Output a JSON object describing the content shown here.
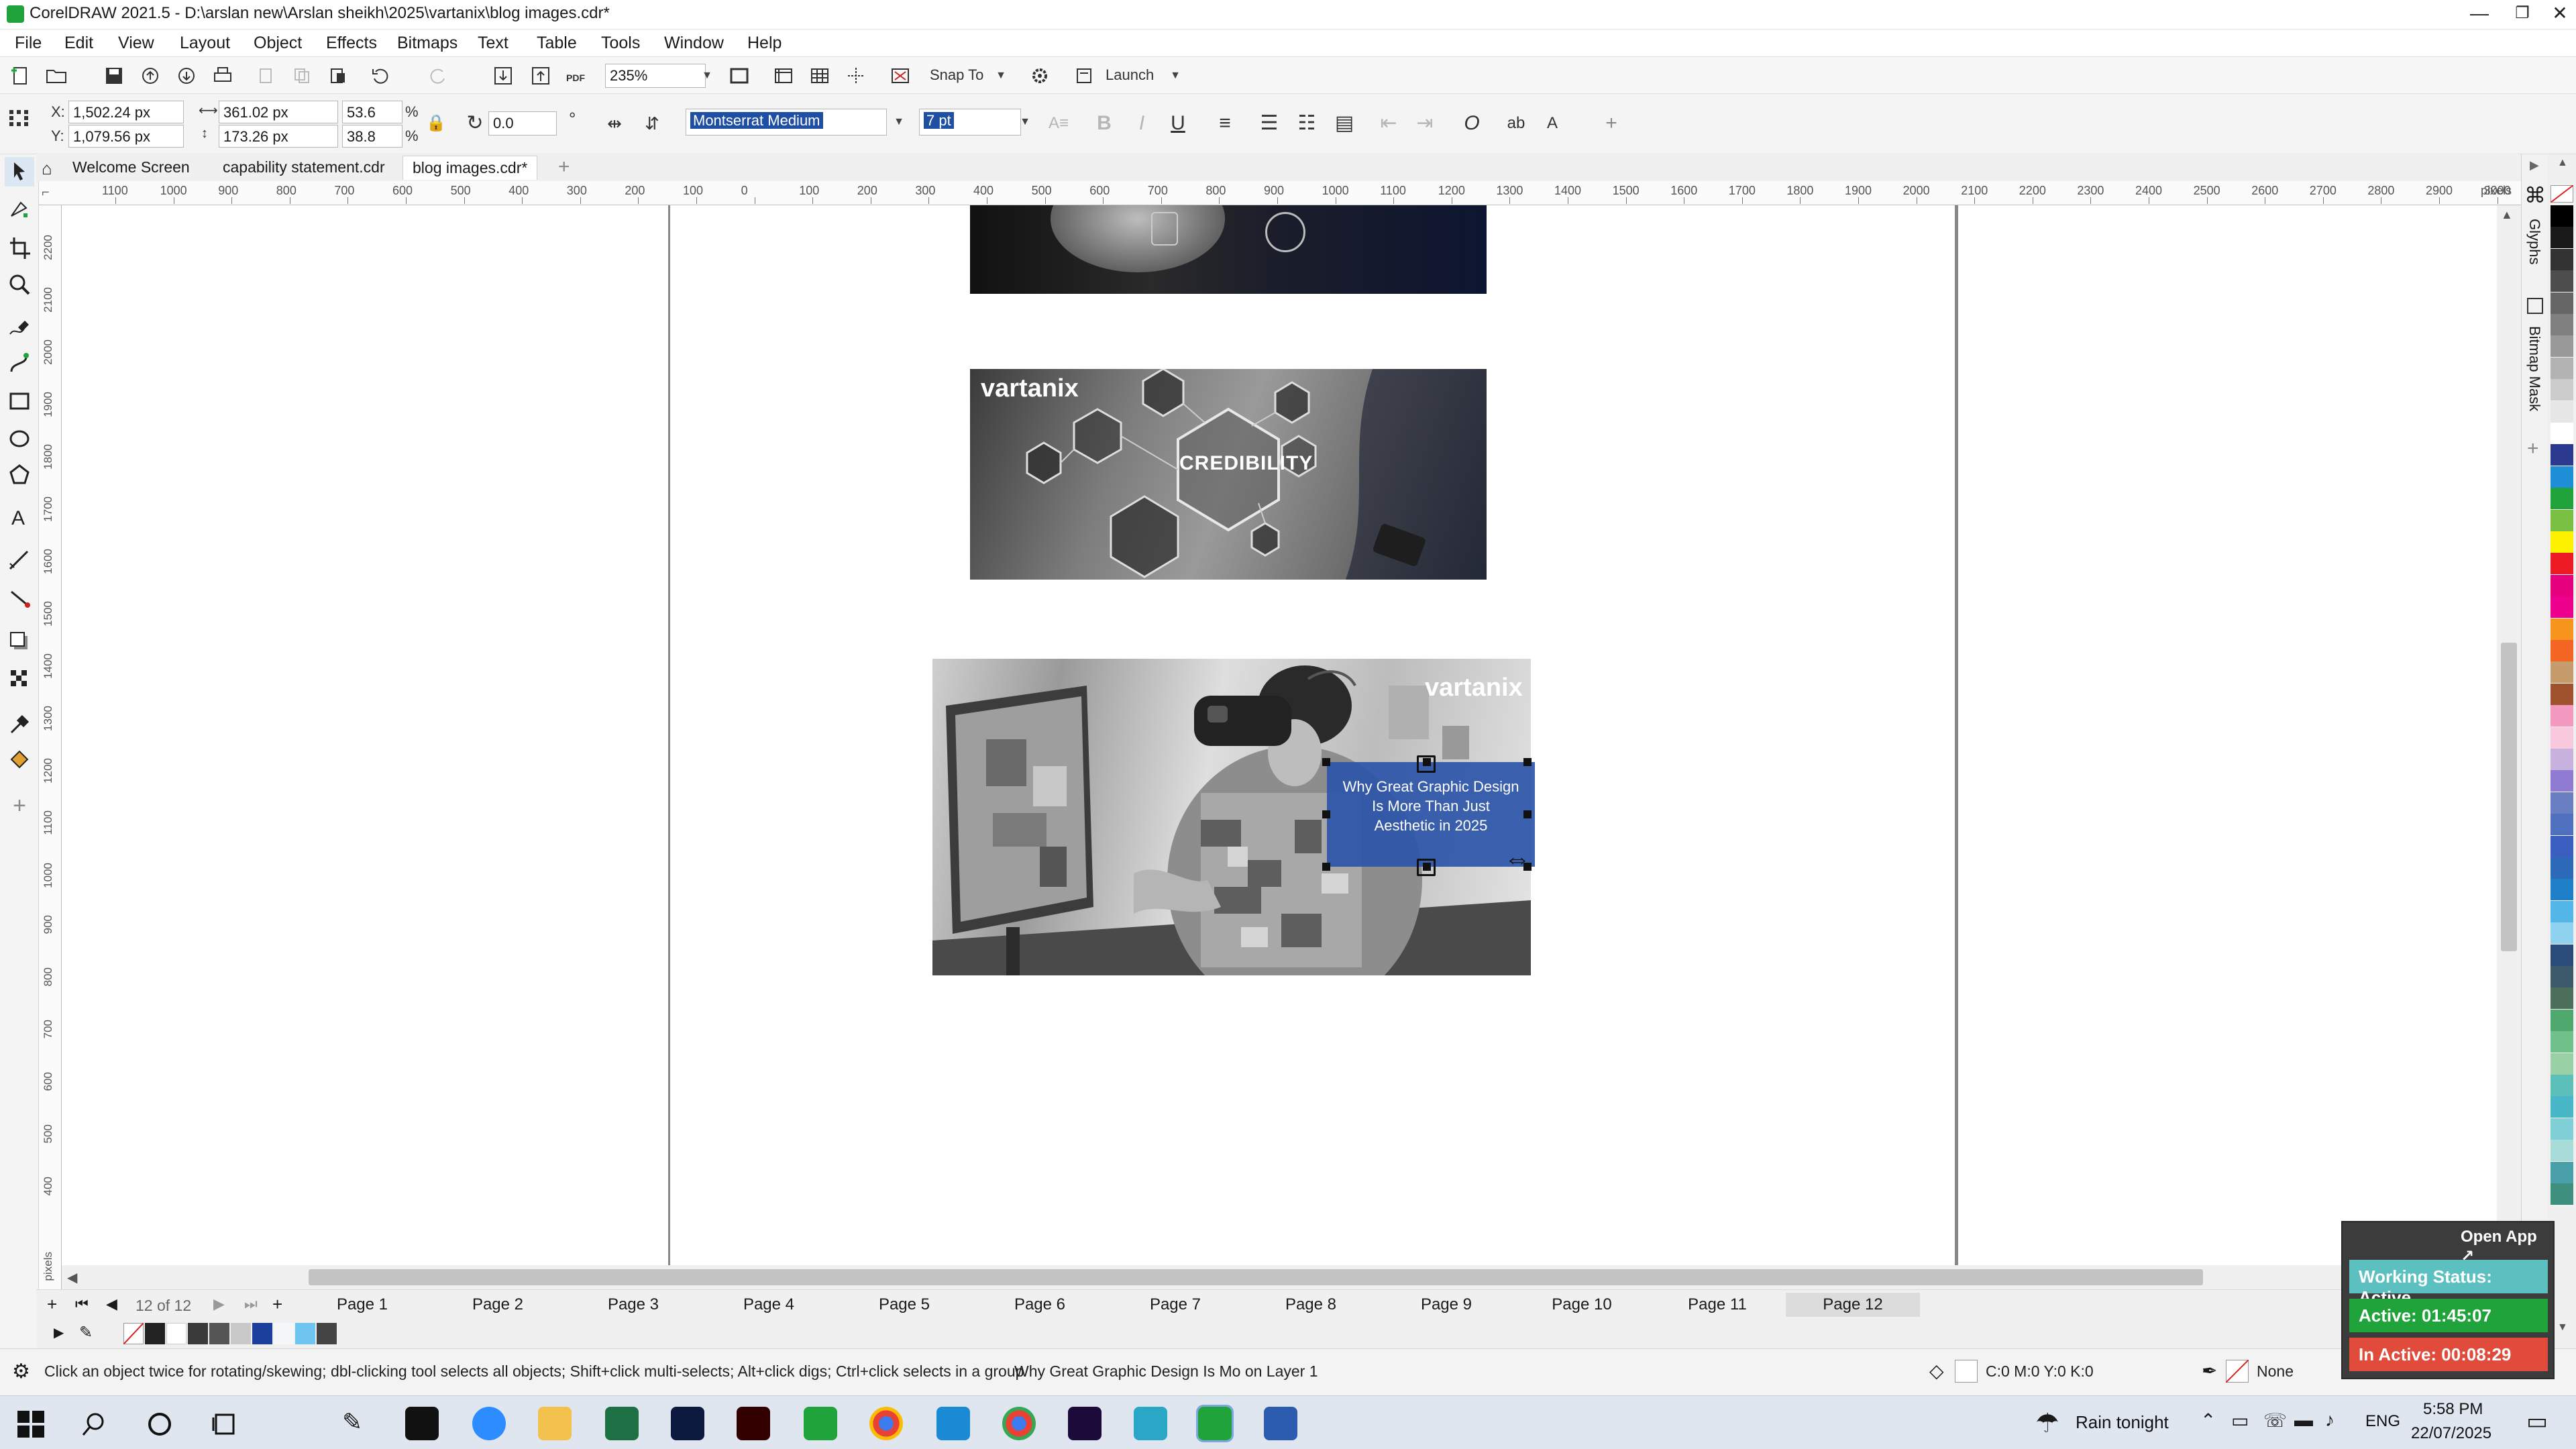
{
  "window": {
    "title": "CorelDRAW 2021.5 - D:\\arslan new\\Arslan sheikh\\2025\\vartanix\\blog images.cdr*",
    "minimize": "—",
    "restore": "❐",
    "close": "✕"
  },
  "menu": [
    "File",
    "Edit",
    "View",
    "Layout",
    "Object",
    "Effects",
    "Bitmaps",
    "Text",
    "Table",
    "Tools",
    "Window",
    "Help"
  ],
  "standard_toolbar": {
    "zoom_value": "235%",
    "snap_label": "Snap To",
    "launch_label": "Launch"
  },
  "property_bar": {
    "x_label": "X:",
    "x_value": "1,502.24 px",
    "y_label": "Y:",
    "y_value": "1,079.56 px",
    "width_value": "361.02 px",
    "height_value": "173.26 px",
    "scale_w": "53.6",
    "scale_h": "38.8",
    "percent": "%",
    "rotation_value": "0.0",
    "degree": "°",
    "font_name": "Montserrat Medium",
    "font_size": "7 pt"
  },
  "doc_tabs": [
    {
      "label": "Welcome Screen",
      "active": false
    },
    {
      "label": "capability statement.cdr",
      "active": false
    },
    {
      "label": "blog images.cdr*",
      "active": true
    }
  ],
  "ruler": {
    "h_labels": [
      "1100",
      "1000",
      "900",
      "800",
      "700",
      "600",
      "500",
      "400",
      "300",
      "200",
      "100",
      "0",
      "100",
      "200",
      "300",
      "400",
      "500",
      "600",
      "700",
      "800",
      "900",
      "1000",
      "1100",
      "1200",
      "1300",
      "1400",
      "1500",
      "1600",
      "1700",
      "1800",
      "1900",
      "2000",
      "2100",
      "2200",
      "2300",
      "2400",
      "2500",
      "2600",
      "2700",
      "2800",
      "2900",
      "3000"
    ],
    "unit": "pixels",
    "v_labels": [
      "2200",
      "2100",
      "2000",
      "1900",
      "1800",
      "1700",
      "1600",
      "1500",
      "1400",
      "1300",
      "1200",
      "1100",
      "1000",
      "900",
      "800",
      "700",
      "600",
      "500",
      "400"
    ],
    "v_unit": "pixels"
  },
  "canvas": {
    "image2_logo": "vartanix",
    "image2_word": "CREDIBILITY",
    "image3_logo": "vartanix",
    "text_block": "Why Great Graphic Design Is More Than Just Aesthetic in 2025"
  },
  "docker": {
    "glyphs": "Glyphs",
    "bitmap_mask": "Bitmap Mask"
  },
  "page_nav": {
    "counter": "12 of 12",
    "pages": [
      "Page 1",
      "Page 2",
      "Page 3",
      "Page 4",
      "Page 5",
      "Page 6",
      "Page 7",
      "Page 8",
      "Page 9",
      "Page 10",
      "Page 11",
      "Page 12"
    ],
    "active_page": "Page 12"
  },
  "status": {
    "hint": "Click an object twice for rotating/skewing; dbl-clicking tool selects all objects; Shift+click multi-selects; Alt+click digs; Ctrl+click selects in a group",
    "object_info": "Why Great Graphic Design Is Mo on Layer 1",
    "fill_info": "C:0 M:0 Y:0 K:0",
    "outline_info": "None"
  },
  "tracker_widget": {
    "open_app": "Open App ↗",
    "working_status": "Working Status: Active",
    "active_time": "Active: 01:45:07",
    "inactive_time": "In Active: 00:08:29"
  },
  "taskbar": {
    "weather": "Rain tonight",
    "lang": "ENG",
    "time": "5:58 PM",
    "date": "22/07/2025"
  },
  "colors": {
    "accent_green": "#1fa33a",
    "text_box_blue": "#2c55a8",
    "active_status": "#5cc0c0",
    "active_time": "#1fa33a",
    "inactive_time": "#e14b3b"
  }
}
